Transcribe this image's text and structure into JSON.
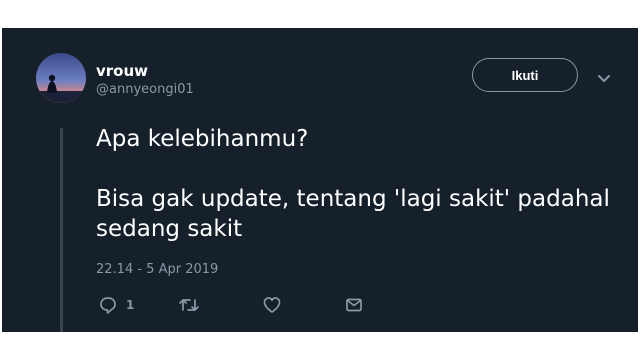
{
  "tweet": {
    "display_name": "vrouw",
    "handle": "@annyeongi01",
    "text_line1": "Apa kelebihanmu?",
    "text_line2": "Bisa gak update, tentang 'lagi sakit' padahal sedang sakit",
    "timestamp": "22.14 - 5 Apr 2019"
  },
  "follow_button": {
    "label": "Ikuti"
  },
  "actions": {
    "reply_count": "1",
    "icons": [
      "reply-icon",
      "retweet-icon",
      "like-icon",
      "message-icon"
    ]
  },
  "colors": {
    "background": "#15202b",
    "text_primary": "#ffffff",
    "text_secondary": "#8899a6",
    "border": "#38444d"
  }
}
